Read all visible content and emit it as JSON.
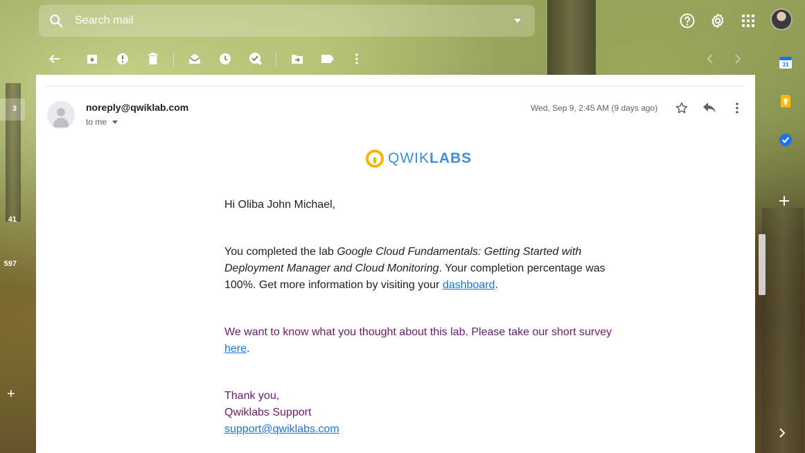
{
  "search": {
    "placeholder": "Search mail"
  },
  "left_rail": {
    "counts": [
      "3",
      "41",
      "597"
    ]
  },
  "email": {
    "sender": "noreply@qwiklab.com",
    "recipient": "to me",
    "date": "Wed, Sep 9, 2:45 AM (9 days ago)",
    "logo_text_light": "QWIK",
    "logo_text_bold": "LABS",
    "greeting": "Hi Oliba John Michael,",
    "para1_prefix": "You completed the lab ",
    "para1_lab": "Google Cloud Fundamentals: Getting Started with Deployment Manager and Cloud Monitoring",
    "para1_suffix": ". Your completion percentage was 100%. Get more information by visiting your ",
    "para1_link": "dashboard",
    "para1_end": ".",
    "para2_prefix": "We want to know what you thought about this lab. Please take our short survey ",
    "para2_link": "here",
    "para2_end": ".",
    "closing": "Thank you,",
    "signature": "Qwiklabs Support",
    "support_email": "support@qwiklabs.com"
  },
  "icons": {
    "top": [
      "search-icon",
      "help-icon",
      "settings-icon",
      "apps-icon",
      "account-avatar"
    ],
    "toolbar": [
      "back-icon",
      "archive-icon",
      "report-spam-icon",
      "delete-icon",
      "mark-unread-icon",
      "snooze-icon",
      "add-task-icon",
      "move-to-icon",
      "label-icon",
      "more-icon",
      "newer-icon",
      "older-icon"
    ],
    "right_rail": [
      "calendar-icon",
      "keep-icon",
      "tasks-icon",
      "add-addon-icon",
      "expand-icon"
    ]
  },
  "colors": {
    "link": "#1a73e8",
    "purple_text": "#6a1b6a",
    "logo_yellow": "#f7b500",
    "logo_blue": "#3c8fd8"
  }
}
